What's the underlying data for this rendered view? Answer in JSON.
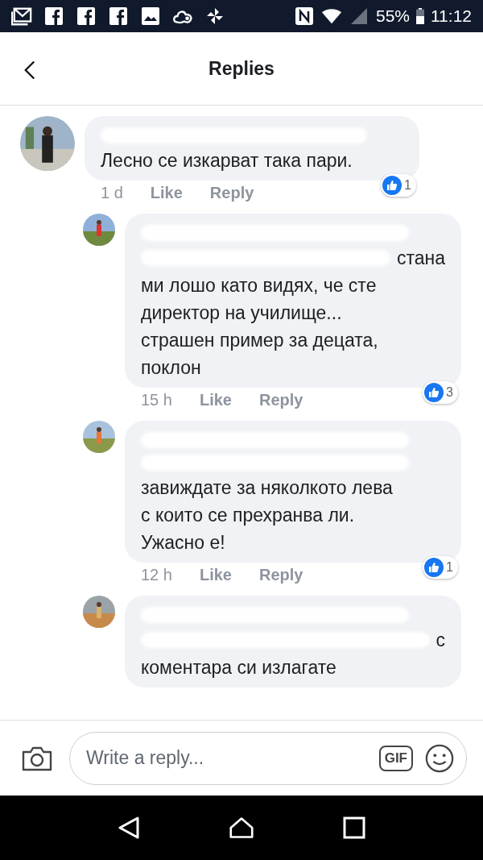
{
  "status_bar": {
    "battery": "55%",
    "time": "11:12"
  },
  "header": {
    "title": "Replies"
  },
  "comments": [
    {
      "lines": [
        {
          "kind": "redacted"
        },
        {
          "kind": "text",
          "text": "Лесно се изкарват така пари."
        }
      ],
      "time": "1 d",
      "like": "Like",
      "reply": "Reply",
      "reactions": "1",
      "children": [
        {
          "lines": [
            {
              "kind": "redacted"
            },
            {
              "kind": "mixed",
              "text": "стана"
            },
            {
              "kind": "text",
              "text": "ми лошо като видях, че сте"
            },
            {
              "kind": "text",
              "text": "директор на училище..."
            },
            {
              "kind": "text",
              "text": "страшен пример за децата,"
            },
            {
              "kind": "text",
              "text": "поклон"
            }
          ],
          "time": "15 h",
          "like": "Like",
          "reply": "Reply",
          "reactions": "3"
        },
        {
          "lines": [
            {
              "kind": "redacted"
            },
            {
              "kind": "redacted"
            },
            {
              "kind": "text",
              "text": "завиждате за няколкото лева"
            },
            {
              "kind": "text",
              "text": "с които се прехранва ли."
            },
            {
              "kind": "text",
              "text": "Ужасно е!"
            }
          ],
          "time": "12 h",
          "like": "Like",
          "reply": "Reply",
          "reactions": "1"
        },
        {
          "lines": [
            {
              "kind": "redacted"
            },
            {
              "kind": "mixed",
              "text": "с"
            },
            {
              "kind": "text",
              "text": "коментара си излагате"
            }
          ]
        }
      ]
    }
  ],
  "composer": {
    "placeholder": "Write a reply...",
    "gif": "GIF"
  }
}
